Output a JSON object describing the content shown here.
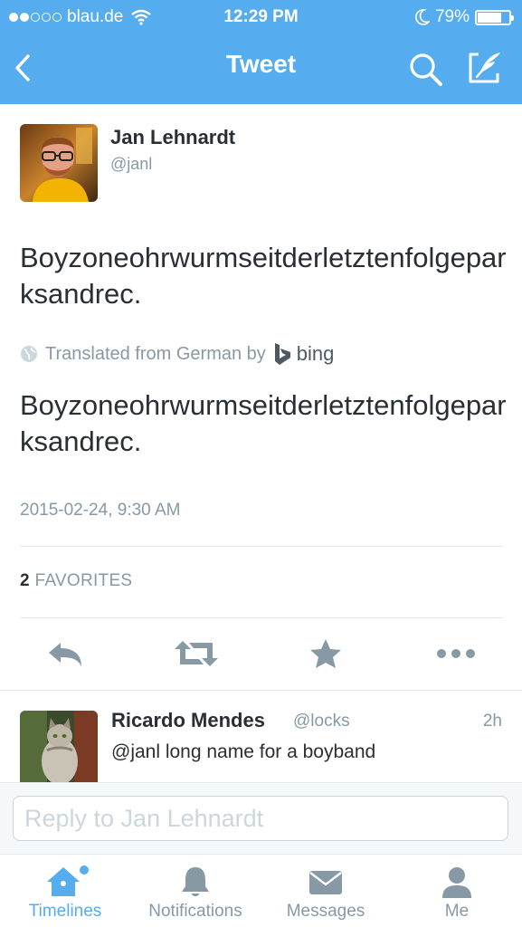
{
  "status_bar": {
    "carrier": "blau.de",
    "time": "12:29 PM",
    "battery_text": "79%",
    "battery_level": 0.79
  },
  "nav": {
    "title": "Tweet",
    "back_icon": "chevron-left-icon",
    "search_icon": "search-icon",
    "compose_icon": "compose-icon"
  },
  "tweet": {
    "author_name": "Jan Lehnardt",
    "author_handle": "@janl",
    "text": "Boyzoneohrwurmseitderletztenfolgeparksandrec.",
    "translated_label": "Translated from German by",
    "translator": "bing",
    "translated_text": "Boyzoneohrwurmseitderletztenfolgeparksandrec.",
    "timestamp": "2015-02-24, 9:30 AM",
    "favorites_count": "2",
    "favorites_label": "FAVORITES"
  },
  "actions": [
    {
      "name": "reply",
      "icon": "reply-icon"
    },
    {
      "name": "retweet",
      "icon": "retweet-icon"
    },
    {
      "name": "favorite",
      "icon": "star-icon"
    },
    {
      "name": "more",
      "icon": "more-icon"
    }
  ],
  "reply": {
    "author_name": "Ricardo Mendes",
    "author_handle": "@locks",
    "time": "2h",
    "text": "@janl long name for a boyband"
  },
  "compose": {
    "placeholder": "Reply to Jan Lehnardt"
  },
  "tabs": [
    {
      "label": "Timelines",
      "icon": "home-icon",
      "active": true
    },
    {
      "label": "Notifications",
      "icon": "bell-icon",
      "active": false
    },
    {
      "label": "Messages",
      "icon": "envelope-icon",
      "active": false
    },
    {
      "label": "Me",
      "icon": "person-icon",
      "active": false
    }
  ],
  "colors": {
    "brand_blue": "#55acee",
    "text_dark": "#292f33",
    "text_gray": "#8899a6"
  }
}
